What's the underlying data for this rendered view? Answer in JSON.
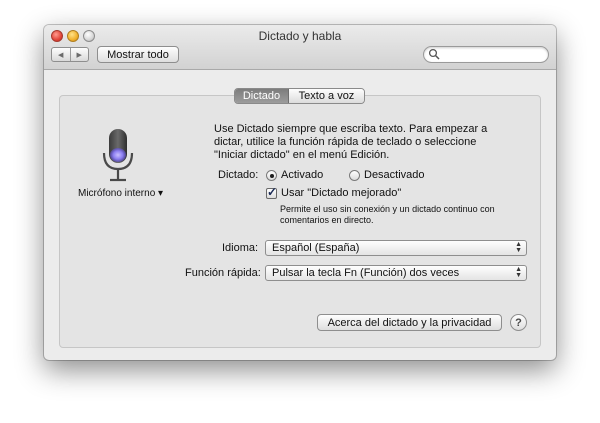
{
  "window": {
    "title": "Dictado y habla"
  },
  "toolbar": {
    "back_glyph": "◀",
    "forward_glyph": "▶",
    "show_all_label": "Mostrar todo",
    "search_placeholder": ""
  },
  "tabs": [
    {
      "label": "Dictado",
      "selected": true
    },
    {
      "label": "Texto a voz",
      "selected": false
    }
  ],
  "mic": {
    "icon": "microphone-icon",
    "source_label": "Micrófono interno ▾"
  },
  "description": "Use Dictado siempre que escriba texto. Para empezar a dictar, utilice la función rápida de teclado o seleccione \"Iniciar dictado\" en el menú Edición.",
  "dictation": {
    "label": "Dictado:",
    "options": [
      {
        "label": "Activado",
        "selected": true
      },
      {
        "label": "Desactivado",
        "selected": false
      }
    ]
  },
  "enhanced": {
    "label": "Usar \"Dictado mejorado\"",
    "checked": true,
    "note_line1": "Permite el uso sin conexión y un dictado continuo con",
    "note_line2": "comentarios en directo."
  },
  "language": {
    "label": "Idioma:",
    "value": "Español (España)"
  },
  "shortcut": {
    "label": "Función rápida:",
    "value": "Pulsar la tecla Fn (Función) dos veces"
  },
  "about_button": "Acerca del dictado y la privacidad",
  "help_button": "?",
  "colors": {
    "tab_selected": "#8a8a8a",
    "mic_glow": "#8a7cf0",
    "window_bg": "#ececec"
  }
}
